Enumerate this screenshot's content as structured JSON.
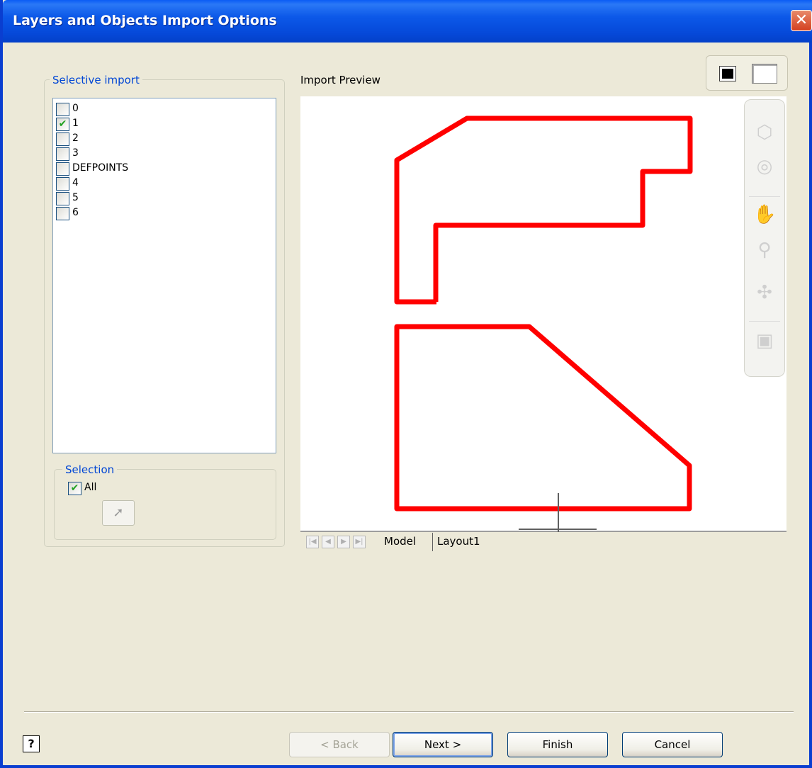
{
  "window": {
    "title": "Layers and Objects Import Options",
    "close_glyph": "✕"
  },
  "selective_import": {
    "legend": "Selective import",
    "layers": [
      {
        "label": "0",
        "checked": false
      },
      {
        "label": "1",
        "checked": true
      },
      {
        "label": "2",
        "checked": false
      },
      {
        "label": "3",
        "checked": false
      },
      {
        "label": "DEFPOINTS",
        "checked": false
      },
      {
        "label": "4",
        "checked": false
      },
      {
        "label": "5",
        "checked": false
      },
      {
        "label": "6",
        "checked": false
      }
    ],
    "check_glyph": "✔"
  },
  "selection": {
    "legend": "Selection",
    "all_label": "All",
    "all_checked": true,
    "pick_icon": "arrow-cursor"
  },
  "preview": {
    "label": "Import Preview",
    "stroke_color": "#ff0000",
    "tabs": [
      "Model",
      "Layout1"
    ],
    "active_tab": "Model"
  },
  "footer": {
    "help_glyph": "?",
    "back_label": "< Back",
    "next_label": "Next >",
    "finish_label": "Finish",
    "cancel_label": "Cancel"
  }
}
